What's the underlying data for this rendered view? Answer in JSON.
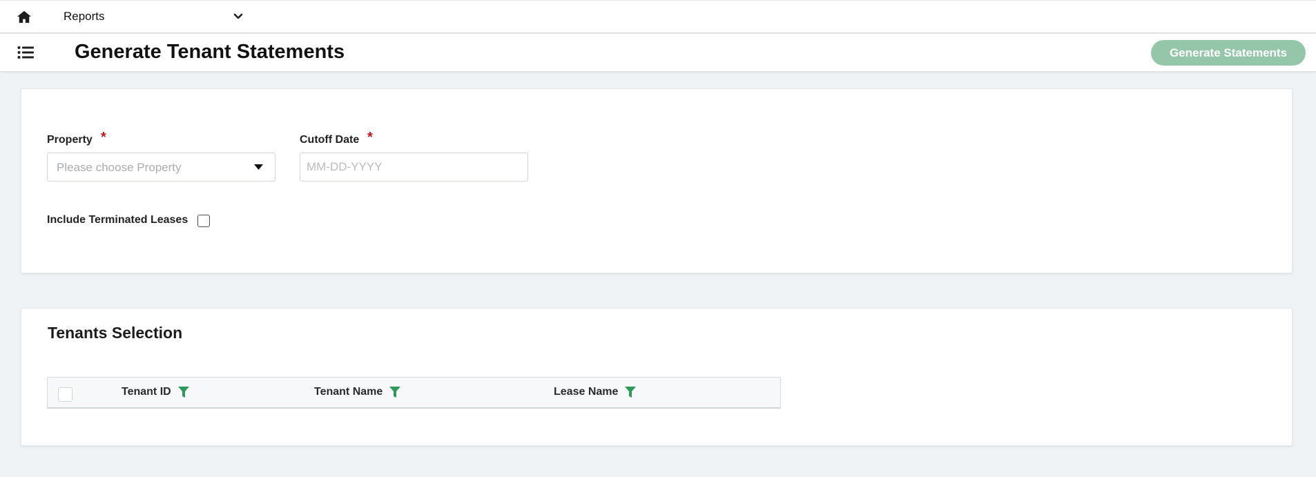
{
  "topbar": {
    "module": "Reports"
  },
  "header": {
    "title": "Generate Tenant Statements",
    "generate_button": "Generate Statements"
  },
  "form": {
    "property_label": "Property",
    "property_placeholder": "Please choose Property",
    "cutoff_label": "Cutoff Date",
    "cutoff_placeholder": "MM-DD-YYYY",
    "required_mark": "*",
    "include_terminated_label": "Include Terminated Leases",
    "include_terminated_checked": false
  },
  "tenants": {
    "title": "Tenants Selection",
    "columns": [
      "Tenant ID",
      "Tenant Name",
      "Lease Name"
    ]
  },
  "colors": {
    "accent": "#2e9a5a",
    "button_disabled": "#8fc4a6",
    "required": "#c0141e"
  }
}
